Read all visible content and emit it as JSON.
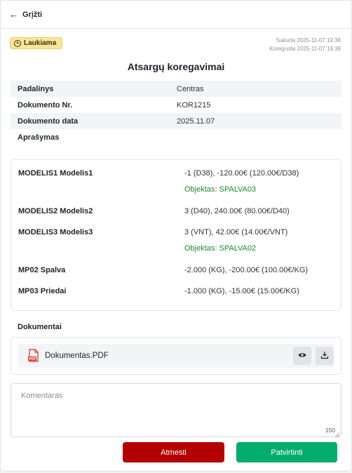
{
  "header": {
    "back_label": "Grįžti"
  },
  "status": {
    "badge_label": "Laukiama",
    "created": "Sukurta 2025-11-07 19:38",
    "edited": "Koreguota 2025-11-07 19:38"
  },
  "title": "Atsargų koregavimai",
  "info": [
    {
      "label": "Padalinys",
      "value": "Centras"
    },
    {
      "label": "Dokumento Nr.",
      "value": "KOR1215"
    },
    {
      "label": "Dokumento data",
      "value": "2025.11.07"
    },
    {
      "label": "Aprašymas",
      "value": ""
    }
  ],
  "items": [
    {
      "name": "MODELIS1 Modelis1",
      "value": "-1 (D38), -120.00€ (120.00€/D38)",
      "object": "Objektas: SPALVA03"
    },
    {
      "name": "MODELIS2 Modelis2",
      "value": "3 (D40), 240.00€ (80.00€/D40)",
      "object": ""
    },
    {
      "name": "MODELIS3 Modelis3",
      "value": "3 (VNT), 42.00€ (14.00€/VNT)",
      "object": "Objektas: SPALVA02"
    },
    {
      "name": "MP02 Spalva",
      "value": "-2.000 (KG), -200.00€ (100.00€/KG)",
      "object": ""
    },
    {
      "name": "MP03 Priedai",
      "value": "-1.000 (KG), -15.00€ (15.00€/KG)",
      "object": ""
    }
  ],
  "documents": {
    "heading": "Dokumentai",
    "files": [
      {
        "name": "Dokumentas.PDF",
        "icon": "pdf-file-icon"
      }
    ]
  },
  "comment": {
    "placeholder": "Komentaras",
    "counter": "150"
  },
  "actions": {
    "reject_label": "Atmesti",
    "confirm_label": "Patvirtinti"
  },
  "colors": {
    "badge_bg": "#fae59a",
    "object_text": "#1e8a2a",
    "reject": "#b40000",
    "confirm": "#03ad6c",
    "pdf_red": "#d93025"
  }
}
